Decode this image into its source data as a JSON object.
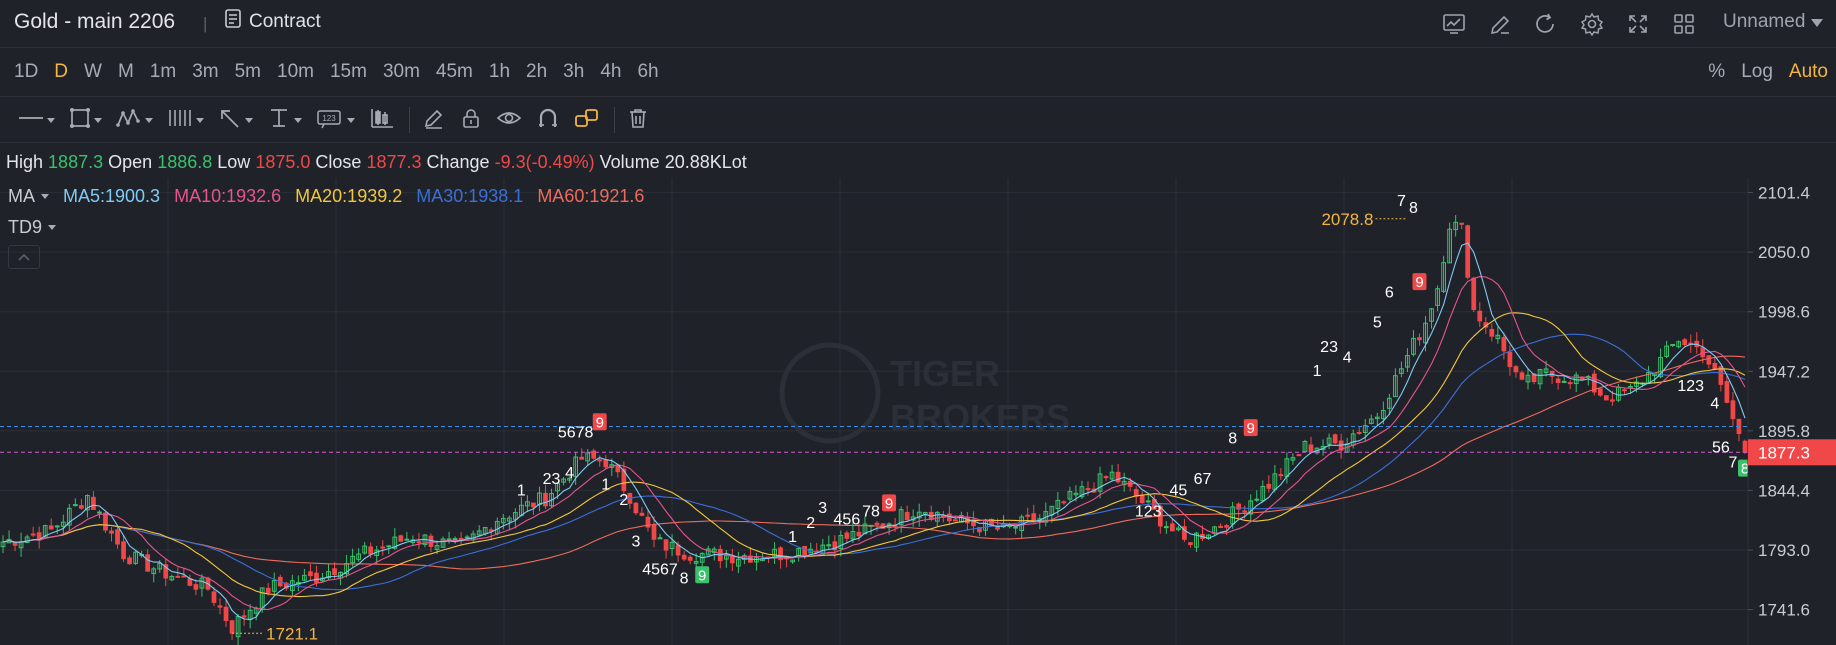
{
  "header": {
    "title": "Gold - main 2206",
    "separator": "|",
    "contract_label": "Contract",
    "layout_name": "Unnamed"
  },
  "intervals": {
    "items": [
      "1D",
      "D",
      "W",
      "M",
      "1m",
      "3m",
      "5m",
      "10m",
      "15m",
      "30m",
      "45m",
      "1h",
      "2h",
      "3h",
      "4h",
      "6h"
    ],
    "active": "D"
  },
  "scale_options": {
    "percent": "%",
    "log": "Log",
    "auto": "Auto",
    "active": "Auto"
  },
  "ohlc": {
    "high_label": "High",
    "high": "1887.3",
    "open_label": "Open",
    "open": "1886.8",
    "low_label": "Low",
    "low": "1875.0",
    "close_label": "Close",
    "close": "1877.3",
    "change_label": "Change",
    "change": "-9.3(-0.49%)",
    "volume_label": "Volume",
    "volume": "20.88KLot"
  },
  "indicators": {
    "ma_label": "MA",
    "ma5": "MA5:1900.3",
    "ma10": "MA10:1932.6",
    "ma20": "MA20:1939.2",
    "ma30": "MA30:1938.1",
    "ma60": "MA60:1921.6",
    "td_label": "TD9"
  },
  "colors": {
    "up": "#39c16b",
    "down": "#f04848",
    "accent": "#f3b53f",
    "ma5": "#7fcbf5",
    "ma10": "#e8548d",
    "ma20": "#f3c73a",
    "ma30": "#3a6fd8",
    "ma60": "#ee6b5c",
    "last_price_line": "#d45ad8",
    "ref_line": "#3a8fe8"
  },
  "watermark": {
    "line1": "TIGER",
    "line2": "BROKERS"
  },
  "chart_data": {
    "type": "candlestick",
    "y_axis_ticks": [
      "2101.4",
      "2050.0",
      "1998.6",
      "1947.2",
      "1895.8",
      "1844.4",
      "1793.0",
      "1741.6"
    ],
    "y_tick_values": [
      2101.4,
      2050.0,
      1998.6,
      1947.2,
      1895.8,
      1844.4,
      1793.0,
      1741.6
    ],
    "ylim": [
      1711.0,
      2114.0
    ],
    "last_price": 1877.3,
    "last_price_label": "1877.3",
    "reference_price": 1899.6,
    "high_marker": {
      "label": "2078.8",
      "value": 2078.8
    },
    "low_marker": {
      "label": "1721.1",
      "value": 1721.1
    },
    "n_bars": 290,
    "key_closes": [
      [
        0,
        1800
      ],
      [
        8,
        1810
      ],
      [
        14,
        1840
      ],
      [
        20,
        1790
      ],
      [
        26,
        1775
      ],
      [
        34,
        1760
      ],
      [
        38,
        1726
      ],
      [
        44,
        1760
      ],
      [
        52,
        1770
      ],
      [
        60,
        1790
      ],
      [
        68,
        1805
      ],
      [
        76,
        1795
      ],
      [
        82,
        1820
      ],
      [
        90,
        1838
      ],
      [
        96,
        1872
      ],
      [
        100,
        1870
      ],
      [
        104,
        1840
      ],
      [
        108,
        1800
      ],
      [
        114,
        1790
      ],
      [
        122,
        1788
      ],
      [
        130,
        1790
      ],
      [
        138,
        1800
      ],
      [
        146,
        1815
      ],
      [
        152,
        1830
      ],
      [
        158,
        1818
      ],
      [
        166,
        1810
      ],
      [
        172,
        1820
      ],
      [
        178,
        1840
      ],
      [
        184,
        1858
      ],
      [
        190,
        1830
      ],
      [
        196,
        1800
      ],
      [
        202,
        1815
      ],
      [
        210,
        1850
      ],
      [
        216,
        1882
      ],
      [
        222,
        1885
      ],
      [
        228,
        1910
      ],
      [
        232,
        1950
      ],
      [
        236,
        1990
      ],
      [
        238,
        2020
      ],
      [
        240,
        2075
      ],
      [
        242,
        2070
      ],
      [
        244,
        2000
      ],
      [
        248,
        1975
      ],
      [
        252,
        1935
      ],
      [
        256,
        1945
      ],
      [
        262,
        1940
      ],
      [
        266,
        1925
      ],
      [
        270,
        1930
      ],
      [
        274,
        1950
      ],
      [
        278,
        1975
      ],
      [
        282,
        1965
      ],
      [
        284,
        1945
      ],
      [
        286,
        1920
      ],
      [
        288,
        1892
      ],
      [
        289,
        1877.3
      ]
    ],
    "td_labels": [
      {
        "bar": 95,
        "value": 1890,
        "text": "5678",
        "color": "#ffffff"
      },
      {
        "bar": 99,
        "value": 1898,
        "text": "9",
        "color": "#f04848",
        "boxed": true
      },
      {
        "bar": 94,
        "value": 1855,
        "text": "4",
        "color": "#ffffff"
      },
      {
        "bar": 91,
        "value": 1850,
        "text": "23",
        "color": "#ffffff"
      },
      {
        "bar": 86,
        "value": 1840,
        "text": "1",
        "color": "#ffffff"
      },
      {
        "bar": 100,
        "value": 1845,
        "text": "1",
        "color": "#ffffff"
      },
      {
        "bar": 103,
        "value": 1832,
        "text": "2",
        "color": "#ffffff"
      },
      {
        "bar": 105,
        "value": 1796,
        "text": "3",
        "color": "#ffffff"
      },
      {
        "bar": 109,
        "value": 1772,
        "text": "4567",
        "color": "#ffffff"
      },
      {
        "bar": 113,
        "value": 1764,
        "text": "8",
        "color": "#ffffff"
      },
      {
        "bar": 116,
        "value": 1766,
        "text": "9",
        "color": "#39c16b",
        "boxed": true
      },
      {
        "bar": 131,
        "value": 1800,
        "text": "1",
        "color": "#ffffff"
      },
      {
        "bar": 134,
        "value": 1812,
        "text": "2",
        "color": "#ffffff"
      },
      {
        "bar": 136,
        "value": 1825,
        "text": "3",
        "color": "#ffffff"
      },
      {
        "bar": 140,
        "value": 1815,
        "text": "456",
        "color": "#ffffff"
      },
      {
        "bar": 144,
        "value": 1822,
        "text": "78",
        "color": "#ffffff"
      },
      {
        "bar": 147,
        "value": 1828,
        "text": "9",
        "color": "#f04848",
        "boxed": true
      },
      {
        "bar": 190,
        "value": 1822,
        "text": "123",
        "color": "#ffffff"
      },
      {
        "bar": 195,
        "value": 1840,
        "text": "45",
        "color": "#ffffff"
      },
      {
        "bar": 199,
        "value": 1850,
        "text": "67",
        "color": "#ffffff"
      },
      {
        "bar": 204,
        "value": 1885,
        "text": "8",
        "color": "#ffffff"
      },
      {
        "bar": 207,
        "value": 1893,
        "text": "9",
        "color": "#f04848",
        "boxed": true
      },
      {
        "bar": 218,
        "value": 1943,
        "text": "1",
        "color": "#ffffff"
      },
      {
        "bar": 220,
        "value": 1964,
        "text": "23",
        "color": "#ffffff"
      },
      {
        "bar": 223,
        "value": 1955,
        "text": "4",
        "color": "#ffffff"
      },
      {
        "bar": 228,
        "value": 1985,
        "text": "5",
        "color": "#ffffff"
      },
      {
        "bar": 230,
        "value": 2011,
        "text": "6",
        "color": "#ffffff"
      },
      {
        "bar": 232,
        "value": 2090,
        "text": "7",
        "color": "#ffffff"
      },
      {
        "bar": 234,
        "value": 2084,
        "text": "8",
        "color": "#ffffff"
      },
      {
        "bar": 235,
        "value": 2019,
        "text": "9",
        "color": "#f04848",
        "boxed": true
      },
      {
        "bar": 280,
        "value": 1930,
        "text": "123",
        "color": "#ffffff"
      },
      {
        "bar": 284,
        "value": 1915,
        "text": "4",
        "color": "#ffffff"
      },
      {
        "bar": 285,
        "value": 1877,
        "text": "56",
        "color": "#ffffff"
      },
      {
        "bar": 287,
        "value": 1864,
        "text": "7",
        "color": "#ffffff"
      },
      {
        "bar": 289,
        "value": 1858,
        "text": "8",
        "color": "#39c16b",
        "boxed": true
      }
    ]
  }
}
